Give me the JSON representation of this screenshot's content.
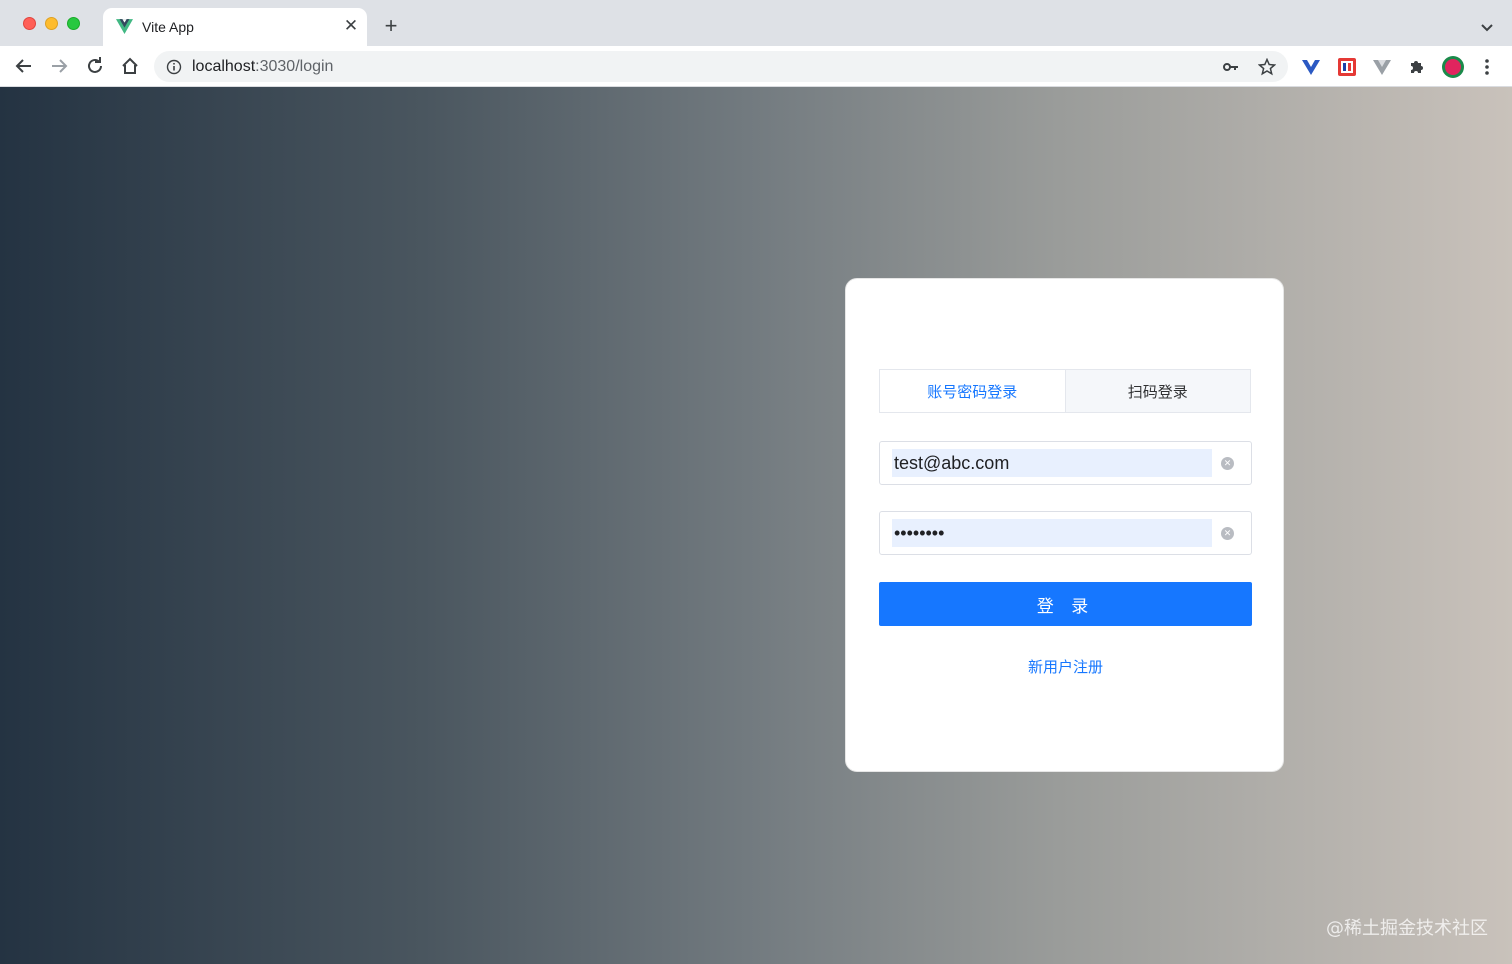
{
  "browser": {
    "tab_title": "Vite App",
    "tab_close_glyph": "✕",
    "new_tab_glyph": "+",
    "url_host": "localhost",
    "url_path": ":3030/login",
    "extensions": [
      "vue-devtools-icon",
      "fe-helper-icon",
      "vite-extension-icon",
      "puzzle-extensions-icon",
      "profile-avatar-icon"
    ]
  },
  "login": {
    "tabs": [
      {
        "label": "账号密码登录",
        "active": true
      },
      {
        "label": "扫码登录",
        "active": false
      }
    ],
    "email": {
      "value": "test@abc.com"
    },
    "password": {
      "value": "password"
    },
    "clear_glyph": "✕",
    "submit_label": "登 录",
    "register_label": "新用户注册"
  },
  "watermark": "@稀土掘金技术社区",
  "colors": {
    "accent": "#1677ff",
    "titlebar": "#dee1e6",
    "autofill": "#e8f0fe"
  }
}
